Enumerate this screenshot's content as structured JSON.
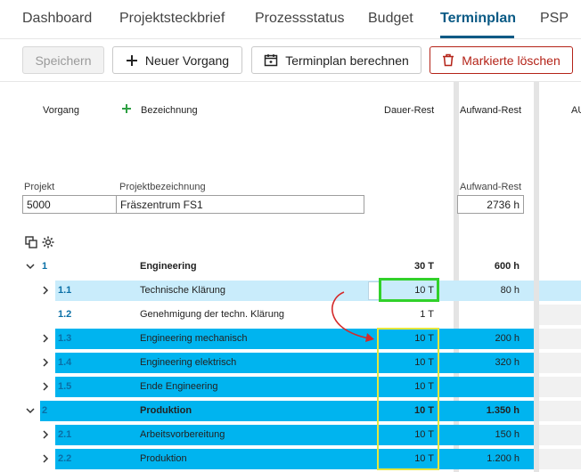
{
  "tabs": [
    {
      "label": "Dashboard",
      "active": false
    },
    {
      "label": "Projektsteckbrief",
      "active": false
    },
    {
      "label": "Prozessstatus",
      "active": false
    },
    {
      "label": "Budget",
      "active": false
    },
    {
      "label": "Terminplan",
      "active": true
    },
    {
      "label": "PSP",
      "active": false
    }
  ],
  "toolbar": {
    "save_label": "Speichern",
    "new_label": "Neuer Vorgang",
    "calc_label": "Terminplan berechnen",
    "delete_label": "Markierte löschen"
  },
  "columns": {
    "vorgang": "Vorgang",
    "bezeichnung": "Bezeichnung",
    "dauer_rest": "Dauer-Rest",
    "aufwand_rest": "Aufwand-Rest",
    "next": "AU"
  },
  "project": {
    "projekt_label": "Projekt",
    "projekt_value": "5000",
    "bez_label": "Projektbezeichnung",
    "bez_value": "Fräszentrum FS1",
    "aufwand_label": "Aufwand-Rest",
    "aufwand_value": "2736 h"
  },
  "rows": [
    {
      "id": "1",
      "name": "Engineering",
      "dauer": "30 T",
      "aufwand": "600 h",
      "level": 0,
      "chevron": "down",
      "bold": true,
      "style": "plain"
    },
    {
      "id": "1.1",
      "name": "Technische Klärung",
      "dauer": "10 T",
      "aufwand": "80 h",
      "level": 1,
      "chevron": "right",
      "bold": false,
      "style": "light"
    },
    {
      "id": "1.2",
      "name": "Genehmigung der techn. Klärung",
      "dauer": "1 T",
      "aufwand": "",
      "level": 1,
      "chevron": "none",
      "bold": false,
      "style": "plain"
    },
    {
      "id": "1.3",
      "name": "Engineering mechanisch",
      "dauer": "10 T",
      "aufwand": "200 h",
      "level": 1,
      "chevron": "right",
      "bold": false,
      "style": "blue"
    },
    {
      "id": "1.4",
      "name": "Engineering elektrisch",
      "dauer": "10 T",
      "aufwand": "320 h",
      "level": 1,
      "chevron": "right",
      "bold": false,
      "style": "blue"
    },
    {
      "id": "1.5",
      "name": "Ende Engineering",
      "dauer": "10 T",
      "aufwand": "",
      "level": 1,
      "chevron": "right",
      "bold": false,
      "style": "blue"
    },
    {
      "id": "2",
      "name": "Produktion",
      "dauer": "10 T",
      "aufwand": "1.350 h",
      "level": 0,
      "chevron": "down",
      "bold": true,
      "style": "blue"
    },
    {
      "id": "2.1",
      "name": "Arbeitsvorbereitung",
      "dauer": "10 T",
      "aufwand": "150 h",
      "level": 1,
      "chevron": "right",
      "bold": false,
      "style": "blue"
    },
    {
      "id": "2.2",
      "name": "Produktion",
      "dauer": "10 T",
      "aufwand": "1.200 h",
      "level": 1,
      "chevron": "right",
      "bold": false,
      "style": "blue"
    }
  ],
  "colors": {
    "accent": "#0a5a85",
    "row_blue": "#00b4ef",
    "row_light": "#c9ecfb",
    "highlight_green": "#31d12a",
    "highlight_yellow": "#e6e63c",
    "arrow_red": "#d42a2a",
    "danger": "#b42318"
  }
}
